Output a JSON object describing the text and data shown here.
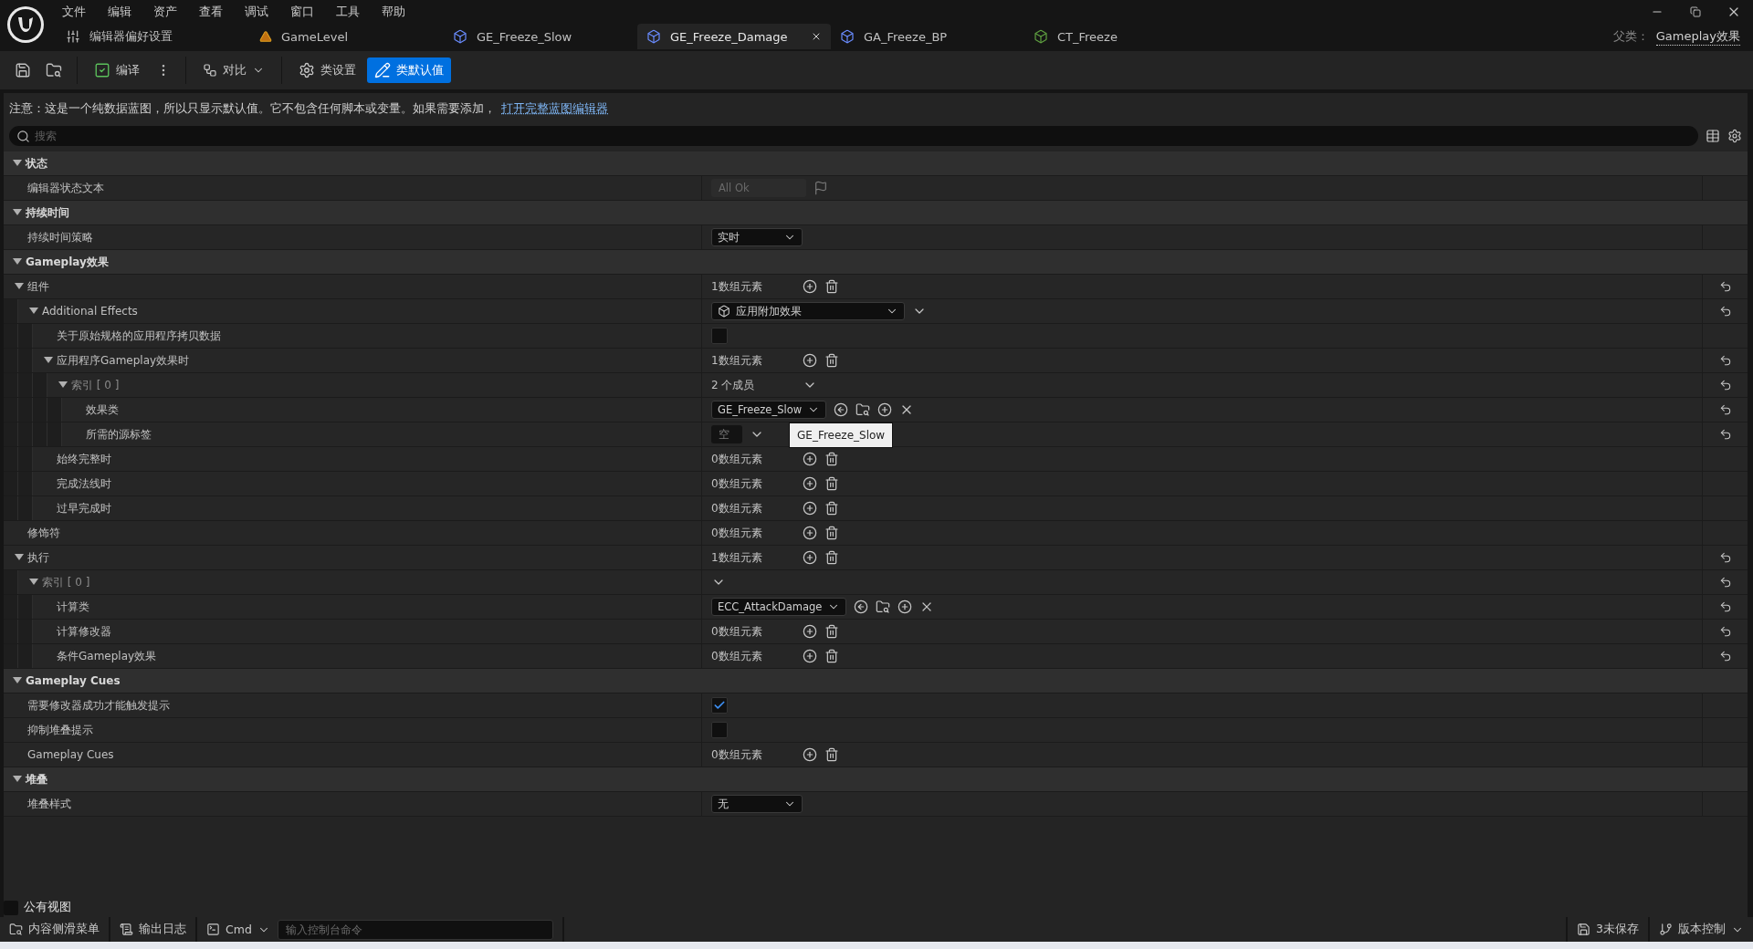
{
  "menu": [
    "文件",
    "编辑",
    "资产",
    "查看",
    "调试",
    "窗口",
    "工具",
    "帮助"
  ],
  "tabs": [
    {
      "label": "编辑器偏好设置",
      "kind": "settings",
      "selected": false
    },
    {
      "label": "GameLevel",
      "kind": "level",
      "selected": false
    },
    {
      "label": "GE_Freeze_Slow",
      "kind": "blueprint",
      "selected": false
    },
    {
      "label": "GE_Freeze_Damage",
      "kind": "blueprint",
      "selected": true
    },
    {
      "label": "GA_Freeze_BP",
      "kind": "blueprint",
      "selected": false
    },
    {
      "label": "CT_Freeze",
      "kind": "class",
      "selected": false
    }
  ],
  "parent_class": {
    "label": "父类：",
    "value": "Gameplay效果"
  },
  "toolbar": {
    "compile": "编译",
    "diff": "对比",
    "modes": [
      {
        "label": "类设置",
        "kind": "settings",
        "selected": false
      },
      {
        "label": "类默认值",
        "kind": "defaults",
        "selected": true
      }
    ]
  },
  "notice": {
    "text": "注意：这是一个纯数据蓝图，所以只显示默认值。它不包含任何脚本或变量。如果需要添加，",
    "link": "打开完整蓝图编辑器"
  },
  "search": {
    "placeholder": "搜索"
  },
  "sections": [
    {
      "label": "状态",
      "expanded": true,
      "children": [
        {
          "label": "编辑器状态文本",
          "kind": "property",
          "reset": false,
          "value": {
            "kind": "status",
            "text": "All Ok"
          }
        }
      ]
    },
    {
      "label": "持续时间",
      "expanded": true,
      "children": [
        {
          "label": "持续时间策略",
          "kind": "property",
          "reset": false,
          "value": {
            "kind": "dropdown",
            "text": "实时"
          }
        }
      ]
    },
    {
      "label": "Gameplay效果",
      "expanded": true,
      "children": [
        {
          "label": "组件",
          "kind": "property",
          "reset": true,
          "expanded": true,
          "value": {
            "kind": "array",
            "text": "1数组元素"
          },
          "children": [
            {
              "label": "Additional Effects",
              "kind": "property",
              "reset": true,
              "expanded": true,
              "value": {
                "kind": "class_dropdown",
                "text": "应用附加效果"
              },
              "children": [
                {
                  "label": "关于原始规格的应用程序拷贝数据",
                  "kind": "property",
                  "reset": false,
                  "value": {
                    "kind": "checkbox",
                    "checked": false
                  }
                },
                {
                  "label": "应用程序Gameplay效果时",
                  "kind": "property",
                  "reset": true,
                  "expanded": true,
                  "value": {
                    "kind": "array",
                    "text": "1数组元素"
                  },
                  "children": [
                    {
                      "label": "索引 [ 0 ]",
                      "kind": "index",
                      "reset": true,
                      "expanded": true,
                      "value": {
                        "kind": "members",
                        "text": "2 个成员"
                      },
                      "children": [
                        {
                          "label": "效果类",
                          "kind": "property",
                          "reset": true,
                          "value": {
                            "kind": "asset",
                            "text": "GE_Freeze_Slow",
                            "tooltip": "GE_Freeze_Slow"
                          }
                        },
                        {
                          "label": "所需的源标签",
                          "kind": "property",
                          "reset": true,
                          "value": {
                            "kind": "tag",
                            "text": "空"
                          }
                        }
                      ]
                    }
                  ]
                },
                {
                  "label": "始终完整时",
                  "kind": "property",
                  "reset": false,
                  "value": {
                    "kind": "array",
                    "text": "0数组元素"
                  }
                },
                {
                  "label": "完成法线时",
                  "kind": "property",
                  "reset": false,
                  "value": {
                    "kind": "array",
                    "text": "0数组元素"
                  }
                },
                {
                  "label": "过早完成时",
                  "kind": "property",
                  "reset": false,
                  "value": {
                    "kind": "array",
                    "text": "0数组元素"
                  }
                }
              ]
            }
          ]
        },
        {
          "label": "修饰符",
          "kind": "property",
          "reset": false,
          "value": {
            "kind": "array",
            "text": "0数组元素"
          }
        },
        {
          "label": "执行",
          "kind": "property",
          "reset": true,
          "expanded": true,
          "value": {
            "kind": "array",
            "text": "1数组元素"
          },
          "children": [
            {
              "label": "索引 [ 0 ]",
              "kind": "index",
              "reset": true,
              "expanded": true,
              "value": {
                "kind": "members"
              },
              "children": [
                {
                  "label": "计算类",
                  "kind": "property",
                  "reset": true,
                  "value": {
                    "kind": "asset",
                    "text": "ECC_AttackDamage"
                  }
                },
                {
                  "label": "计算修改器",
                  "kind": "property",
                  "reset": true,
                  "value": {
                    "kind": "array",
                    "text": "0数组元素"
                  }
                },
                {
                  "label": "条件Gameplay效果",
                  "kind": "property",
                  "reset": true,
                  "value": {
                    "kind": "array",
                    "text": "0数组元素"
                  }
                }
              ]
            }
          ]
        }
      ]
    },
    {
      "label": "Gameplay Cues",
      "expanded": true,
      "children": [
        {
          "label": "需要修改器成功才能触发提示",
          "kind": "property",
          "reset": false,
          "value": {
            "kind": "checkbox",
            "checked": true
          }
        },
        {
          "label": "抑制堆叠提示",
          "kind": "property",
          "reset": false,
          "value": {
            "kind": "checkbox",
            "checked": false
          }
        },
        {
          "label": "Gameplay Cues",
          "kind": "property",
          "reset": false,
          "value": {
            "kind": "array",
            "text": "0数组元素"
          }
        }
      ]
    },
    {
      "label": "堆叠",
      "expanded": true,
      "children": [
        {
          "label": "堆叠样式",
          "kind": "property",
          "reset": false,
          "value": {
            "kind": "dropdown",
            "text": "无"
          }
        }
      ]
    }
  ],
  "public_view": {
    "label": "公有视图",
    "checked": false
  },
  "status_bar": {
    "content_drawer": "内容侧滑菜单",
    "output_log": "输出日志",
    "cmd": "Cmd",
    "console_placeholder": "输入控制台命令",
    "unsaved": "3未保存",
    "source_control": "版本控制"
  }
}
